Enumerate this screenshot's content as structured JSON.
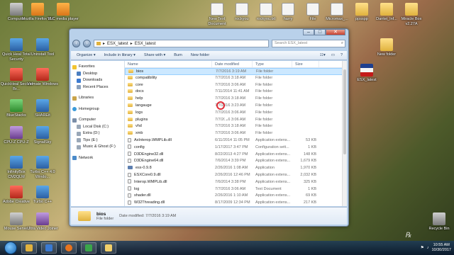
{
  "desktop_icons": [
    {
      "label": "Computer",
      "style": "gray"
    },
    {
      "label": "Mozilla Firefox Bld",
      "style": "orange"
    },
    {
      "label": "VLC media player",
      "style": "orange"
    },
    {
      "label": "New Text Document",
      "style": "doc"
    },
    {
      "label": "rockyou",
      "style": "doc"
    },
    {
      "label": "rockyou.txt",
      "style": "doc"
    },
    {
      "label": "harry",
      "style": "doc"
    },
    {
      "label": "File",
      "style": "doc"
    },
    {
      "label": "Micromax_...",
      "style": "doc"
    },
    {
      "label": "ppsspp",
      "style": "folder"
    },
    {
      "label": "Dantei_Inf...",
      "style": "folder"
    },
    {
      "label": "Miracle Box v2.27A",
      "style": "folder"
    },
    {
      "label": "Quick Heal Total Security",
      "style": "blue"
    },
    {
      "label": "Uninstall Tool",
      "style": "blue"
    },
    {
      "label": "New folder",
      "style": "folder"
    },
    {
      "label": "QuickHeal Secure Br...",
      "style": "red"
    },
    {
      "label": "Vidmate Windows",
      "style": "red"
    },
    {
      "label": "ESX_latest",
      "style": "flag"
    },
    {
      "label": "BlueStacks",
      "style": "green"
    },
    {
      "label": "SHAREit",
      "style": "blue"
    },
    {
      "label": "CPU-Z CPU-Z",
      "style": "purple"
    },
    {
      "label": "SignalSky",
      "style": "blue"
    },
    {
      "label": "InfinityBox CM2QLM",
      "style": "blue"
    },
    {
      "label": "Turbo C++ 4.0 Windo...",
      "style": "blue"
    },
    {
      "label": "Adobe Creative",
      "style": "red"
    },
    {
      "label": "Turbo C++",
      "style": "blue"
    },
    {
      "label": "Mouse Server",
      "style": "gray"
    },
    {
      "label": "Ultra Video Joiner",
      "style": "purple"
    },
    {
      "label": "Recycle Bin",
      "style": "gray"
    }
  ],
  "explorer": {
    "address": {
      "root": "ESX_latest",
      "current": "ESX_latest"
    },
    "search_placeholder": "Search ESX_latest",
    "toolbar": {
      "organize": "Organize ▾",
      "include": "Include in library ▾",
      "share": "Share with ▾",
      "burn": "Burn",
      "new_folder": "New folder"
    },
    "nav": {
      "favorites": "Favorites",
      "desktop": "Desktop",
      "downloads": "Downloads",
      "recent": "Recent Places",
      "libraries": "Libraries",
      "homegroup": "Homegroup",
      "computer": "Computer",
      "local_c": "Local Disk (C:)",
      "extra_d": "Extra (D:)",
      "tips_e": "Tips (E:)",
      "music_f": "Music & Ghost (F:)",
      "network": "Network"
    },
    "columns": {
      "name": "Name",
      "date": "Date modified",
      "type": "Type",
      "size": "Size"
    },
    "files": [
      {
        "name": "bios",
        "date": "7/7/2016 3:19 AM",
        "type": "File folder",
        "size": "",
        "icon": "folder"
      },
      {
        "name": "compatibility",
        "date": "7/7/2016 3:18 AM",
        "type": "File folder",
        "size": "",
        "icon": "folder"
      },
      {
        "name": "core",
        "date": "7/7/2016 3:06 AM",
        "type": "File folder",
        "size": "",
        "icon": "folder"
      },
      {
        "name": "docs",
        "date": "7/11/2014 11:41 AM",
        "type": "File folder",
        "size": "",
        "icon": "folder"
      },
      {
        "name": "help",
        "date": "7/7/2016 3:18 AM",
        "type": "File folder",
        "size": "",
        "icon": "folder"
      },
      {
        "name": "langauge",
        "date": "7/7/2016 3:23 AM",
        "type": "File folder",
        "size": "",
        "icon": "folder"
      },
      {
        "name": "logs",
        "date": "7/7/2016 3:06 AM",
        "type": "File folder",
        "size": "",
        "icon": "folder"
      },
      {
        "name": "plugins",
        "date": "7/7/2016 3:06 AM",
        "type": "File folder",
        "size": "",
        "icon": "folder"
      },
      {
        "name": "vhd",
        "date": "7/7/2016 3:18 AM",
        "type": "File folder",
        "size": "",
        "icon": "folder"
      },
      {
        "name": "xmb",
        "date": "7/7/2016 3:06 AM",
        "type": "File folder",
        "size": "",
        "icon": "folder"
      },
      {
        "name": "AxInterop.WMPLib.dll",
        "date": "6/11/2014 11:05 PM",
        "type": "Application extens...",
        "size": "53 KB",
        "icon": "file"
      },
      {
        "name": "config",
        "date": "1/17/2017 3:47 PM",
        "type": "Configuration sett...",
        "size": "1 KB",
        "icon": "file"
      },
      {
        "name": "D3DEngine32.dll",
        "date": "8/22/2013 4:27 PM",
        "type": "Application extens...",
        "size": "148 KB",
        "icon": "file"
      },
      {
        "name": "D3DEngine64.dll",
        "date": "7/6/2014 3:39 PM",
        "type": "Application extens...",
        "size": "1,679 KB",
        "icon": "file"
      },
      {
        "name": "esx-0.9.8",
        "date": "2/26/2016 1:08 AM",
        "type": "Application",
        "size": "1,970 KB",
        "icon": "app"
      },
      {
        "name": "ESXCore0.9.dll",
        "date": "2/26/2016 12:46 PM",
        "type": "Application extens...",
        "size": "2,032 KB",
        "icon": "file"
      },
      {
        "name": "Interop.WMPLib.dll",
        "date": "7/6/2014 3:38 PM",
        "type": "Application extens...",
        "size": "325 KB",
        "icon": "file"
      },
      {
        "name": "log",
        "date": "7/7/2016 3:06 AM",
        "type": "Text Document",
        "size": "1 KB",
        "icon": "file"
      },
      {
        "name": "shader.dll",
        "date": "2/26/2016 1:10 AM",
        "type": "Application extens...",
        "size": "69 KB",
        "icon": "file"
      },
      {
        "name": "W32Threading.dll",
        "date": "8/17/2009 12:34 PM",
        "type": "Application extens...",
        "size": "217 KB",
        "icon": "file"
      }
    ],
    "details": {
      "name": "bios",
      "modified_label": "Date modified: 7/7/2016 3:19 AM",
      "type": "File folder"
    }
  },
  "taskbar": {
    "time": "10:55 AM",
    "date": "10/30/2017"
  }
}
